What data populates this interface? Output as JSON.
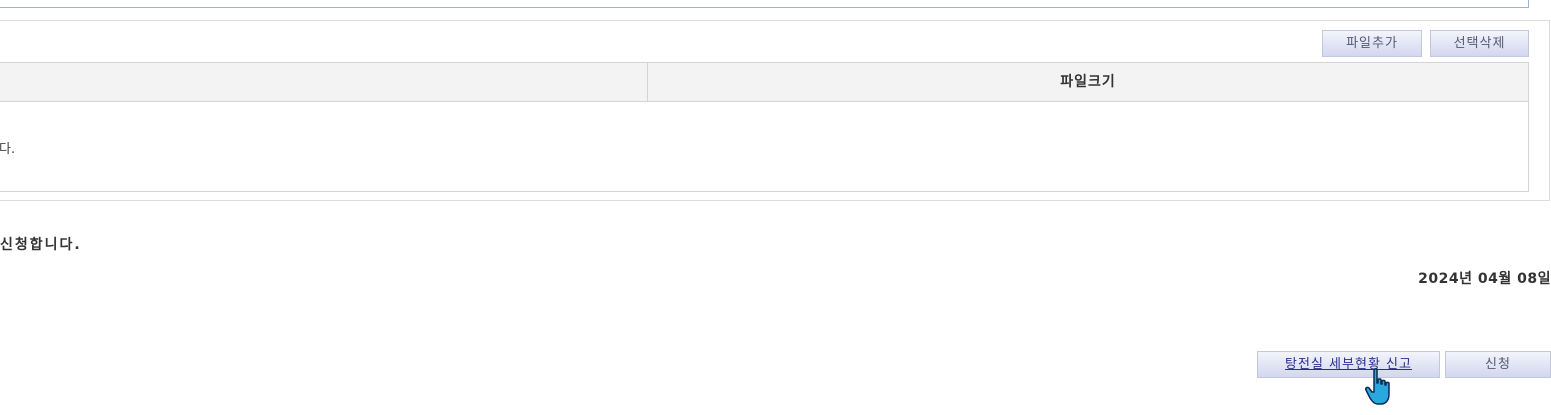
{
  "top_field": {
    "value": ""
  },
  "attachments": {
    "add_file_label": "파일추가",
    "delete_selected_label": "선택삭제",
    "table": {
      "columns": [
        "파일크기"
      ],
      "empty_message": "다."
    }
  },
  "declaration_text": "신청합니다.",
  "date": "2024년 04월 08일",
  "footer": {
    "report_label": "탕전실 세부현황 신고",
    "submit_label": "신청"
  },
  "colors": {
    "button_gradient_top": "#f3f4fb",
    "button_gradient_bottom": "#d3d7ef",
    "table_header_bg": "#f3f3f3",
    "link_color": "#2a2f8f",
    "cursor_color": "#29a8e0"
  },
  "icons": {
    "cursor": "hand-pointer-icon"
  }
}
